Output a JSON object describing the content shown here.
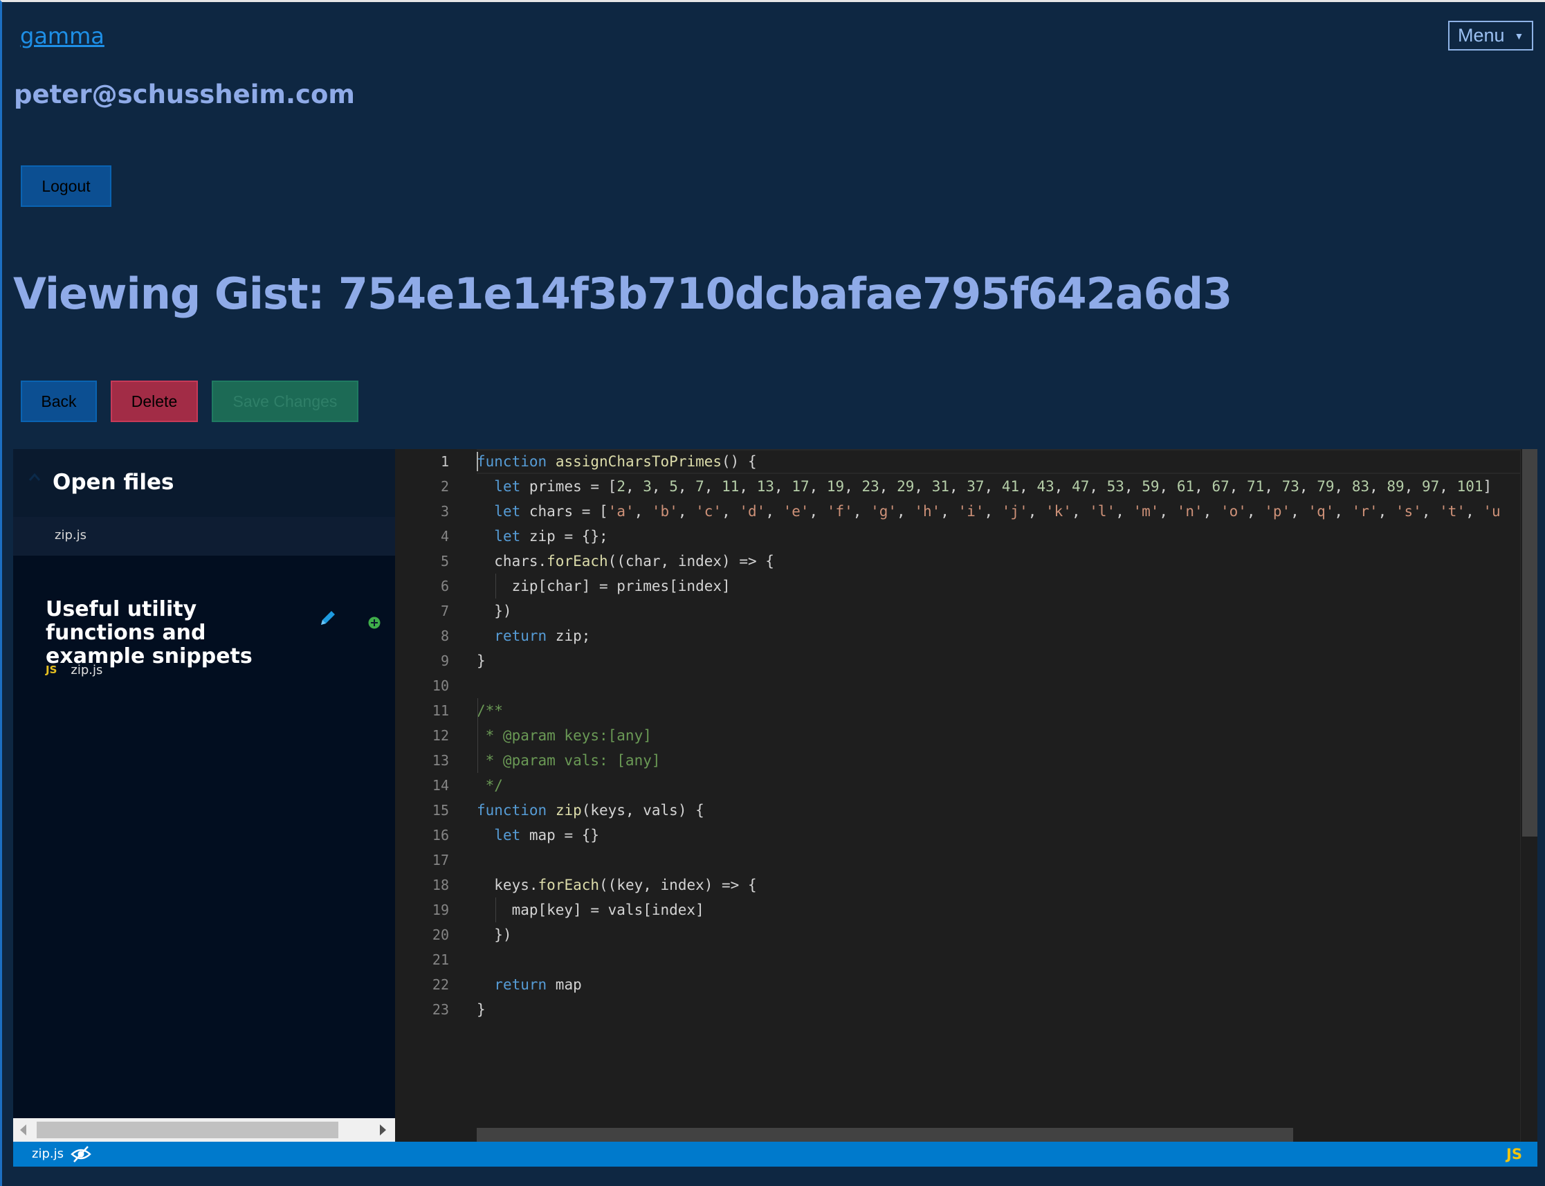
{
  "header": {
    "brand": "gamma",
    "menu_label": "Menu",
    "user_email": "peter@schussheim.com",
    "logout_label": "Logout"
  },
  "gist": {
    "heading": "Viewing Gist: 754e1e14f3b710dcbafae795f642a6d3",
    "back_label": "Back",
    "delete_label": "Delete",
    "save_label": "Save Changes",
    "description": "Useful utility functions and example snippets"
  },
  "sidebar": {
    "open_files_title": "Open files",
    "open_files": [
      "zip.js"
    ],
    "tree_files": [
      {
        "badge": "JS",
        "name": "zip.js"
      }
    ]
  },
  "editor": {
    "line_numbers": [
      "1",
      "2",
      "3",
      "4",
      "5",
      "6",
      "7",
      "8",
      "9",
      "10",
      "11",
      "12",
      "13",
      "14",
      "15",
      "16",
      "17",
      "18",
      "19",
      "20",
      "21",
      "22",
      "23"
    ],
    "active_line": 1,
    "lines": [
      [
        [
          "kw",
          "function"
        ],
        [
          "plain",
          " "
        ],
        [
          "fn",
          "assignCharsToPrimes"
        ],
        [
          "plain",
          "() {"
        ]
      ],
      [
        [
          "plain",
          "  "
        ],
        [
          "kw",
          "let"
        ],
        [
          "plain",
          " primes = ["
        ],
        [
          "num",
          "2"
        ],
        [
          "plain",
          ", "
        ],
        [
          "num",
          "3"
        ],
        [
          "plain",
          ", "
        ],
        [
          "num",
          "5"
        ],
        [
          "plain",
          ", "
        ],
        [
          "num",
          "7"
        ],
        [
          "plain",
          ", "
        ],
        [
          "num",
          "11"
        ],
        [
          "plain",
          ", "
        ],
        [
          "num",
          "13"
        ],
        [
          "plain",
          ", "
        ],
        [
          "num",
          "17"
        ],
        [
          "plain",
          ", "
        ],
        [
          "num",
          "19"
        ],
        [
          "plain",
          ", "
        ],
        [
          "num",
          "23"
        ],
        [
          "plain",
          ", "
        ],
        [
          "num",
          "29"
        ],
        [
          "plain",
          ", "
        ],
        [
          "num",
          "31"
        ],
        [
          "plain",
          ", "
        ],
        [
          "num",
          "37"
        ],
        [
          "plain",
          ", "
        ],
        [
          "num",
          "41"
        ],
        [
          "plain",
          ", "
        ],
        [
          "num",
          "43"
        ],
        [
          "plain",
          ", "
        ],
        [
          "num",
          "47"
        ],
        [
          "plain",
          ", "
        ],
        [
          "num",
          "53"
        ],
        [
          "plain",
          ", "
        ],
        [
          "num",
          "59"
        ],
        [
          "plain",
          ", "
        ],
        [
          "num",
          "61"
        ],
        [
          "plain",
          ", "
        ],
        [
          "num",
          "67"
        ],
        [
          "plain",
          ", "
        ],
        [
          "num",
          "71"
        ],
        [
          "plain",
          ", "
        ],
        [
          "num",
          "73"
        ],
        [
          "plain",
          ", "
        ],
        [
          "num",
          "79"
        ],
        [
          "plain",
          ", "
        ],
        [
          "num",
          "83"
        ],
        [
          "plain",
          ", "
        ],
        [
          "num",
          "89"
        ],
        [
          "plain",
          ", "
        ],
        [
          "num",
          "97"
        ],
        [
          "plain",
          ", "
        ],
        [
          "num",
          "101"
        ],
        [
          "plain",
          "]"
        ]
      ],
      [
        [
          "plain",
          "  "
        ],
        [
          "kw",
          "let"
        ],
        [
          "plain",
          " chars = ["
        ],
        [
          "str",
          "'a'"
        ],
        [
          "plain",
          ", "
        ],
        [
          "str",
          "'b'"
        ],
        [
          "plain",
          ", "
        ],
        [
          "str",
          "'c'"
        ],
        [
          "plain",
          ", "
        ],
        [
          "str",
          "'d'"
        ],
        [
          "plain",
          ", "
        ],
        [
          "str",
          "'e'"
        ],
        [
          "plain",
          ", "
        ],
        [
          "str",
          "'f'"
        ],
        [
          "plain",
          ", "
        ],
        [
          "str",
          "'g'"
        ],
        [
          "plain",
          ", "
        ],
        [
          "str",
          "'h'"
        ],
        [
          "plain",
          ", "
        ],
        [
          "str",
          "'i'"
        ],
        [
          "plain",
          ", "
        ],
        [
          "str",
          "'j'"
        ],
        [
          "plain",
          ", "
        ],
        [
          "str",
          "'k'"
        ],
        [
          "plain",
          ", "
        ],
        [
          "str",
          "'l'"
        ],
        [
          "plain",
          ", "
        ],
        [
          "str",
          "'m'"
        ],
        [
          "plain",
          ", "
        ],
        [
          "str",
          "'n'"
        ],
        [
          "plain",
          ", "
        ],
        [
          "str",
          "'o'"
        ],
        [
          "plain",
          ", "
        ],
        [
          "str",
          "'p'"
        ],
        [
          "plain",
          ", "
        ],
        [
          "str",
          "'q'"
        ],
        [
          "plain",
          ", "
        ],
        [
          "str",
          "'r'"
        ],
        [
          "plain",
          ", "
        ],
        [
          "str",
          "'s'"
        ],
        [
          "plain",
          ", "
        ],
        [
          "str",
          "'t'"
        ],
        [
          "plain",
          ", "
        ],
        [
          "str",
          "'u"
        ]
      ],
      [
        [
          "plain",
          "  "
        ],
        [
          "kw",
          "let"
        ],
        [
          "plain",
          " zip = {};"
        ]
      ],
      [
        [
          "plain",
          "  chars."
        ],
        [
          "fn",
          "forEach"
        ],
        [
          "plain",
          "((char, index) => {"
        ]
      ],
      [
        [
          "plain",
          "    zip[char] = primes[index]"
        ]
      ],
      [
        [
          "plain",
          "  })"
        ]
      ],
      [
        [
          "plain",
          "  "
        ],
        [
          "kw",
          "return"
        ],
        [
          "plain",
          " zip;"
        ]
      ],
      [
        [
          "plain",
          "}"
        ]
      ],
      [],
      [
        [
          "cm",
          "/**"
        ]
      ],
      [
        [
          "cm",
          " * @param keys:[any]"
        ]
      ],
      [
        [
          "cm",
          " * @param vals: [any]"
        ]
      ],
      [
        [
          "cm",
          " */"
        ]
      ],
      [
        [
          "kw",
          "function"
        ],
        [
          "plain",
          " "
        ],
        [
          "fn",
          "zip"
        ],
        [
          "plain",
          "(keys, vals) {"
        ]
      ],
      [
        [
          "plain",
          "  "
        ],
        [
          "kw",
          "let"
        ],
        [
          "plain",
          " map = {}"
        ]
      ],
      [],
      [
        [
          "plain",
          "  keys."
        ],
        [
          "fn",
          "forEach"
        ],
        [
          "plain",
          "((key, index) => {"
        ]
      ],
      [
        [
          "plain",
          "    map[key] = vals[index]"
        ]
      ],
      [
        [
          "plain",
          "  })"
        ]
      ],
      [],
      [
        [
          "plain",
          "  "
        ],
        [
          "kw",
          "return"
        ],
        [
          "plain",
          " map"
        ]
      ],
      [
        [
          "plain",
          "}"
        ]
      ]
    ]
  },
  "status_bar": {
    "filename": "zip.js",
    "language": "JS"
  },
  "colors": {
    "background": "#0e2742",
    "accent_text": "#8fabe8",
    "status_bar": "#007acc",
    "delete": "#a22c46",
    "save": "#1c6a55"
  }
}
